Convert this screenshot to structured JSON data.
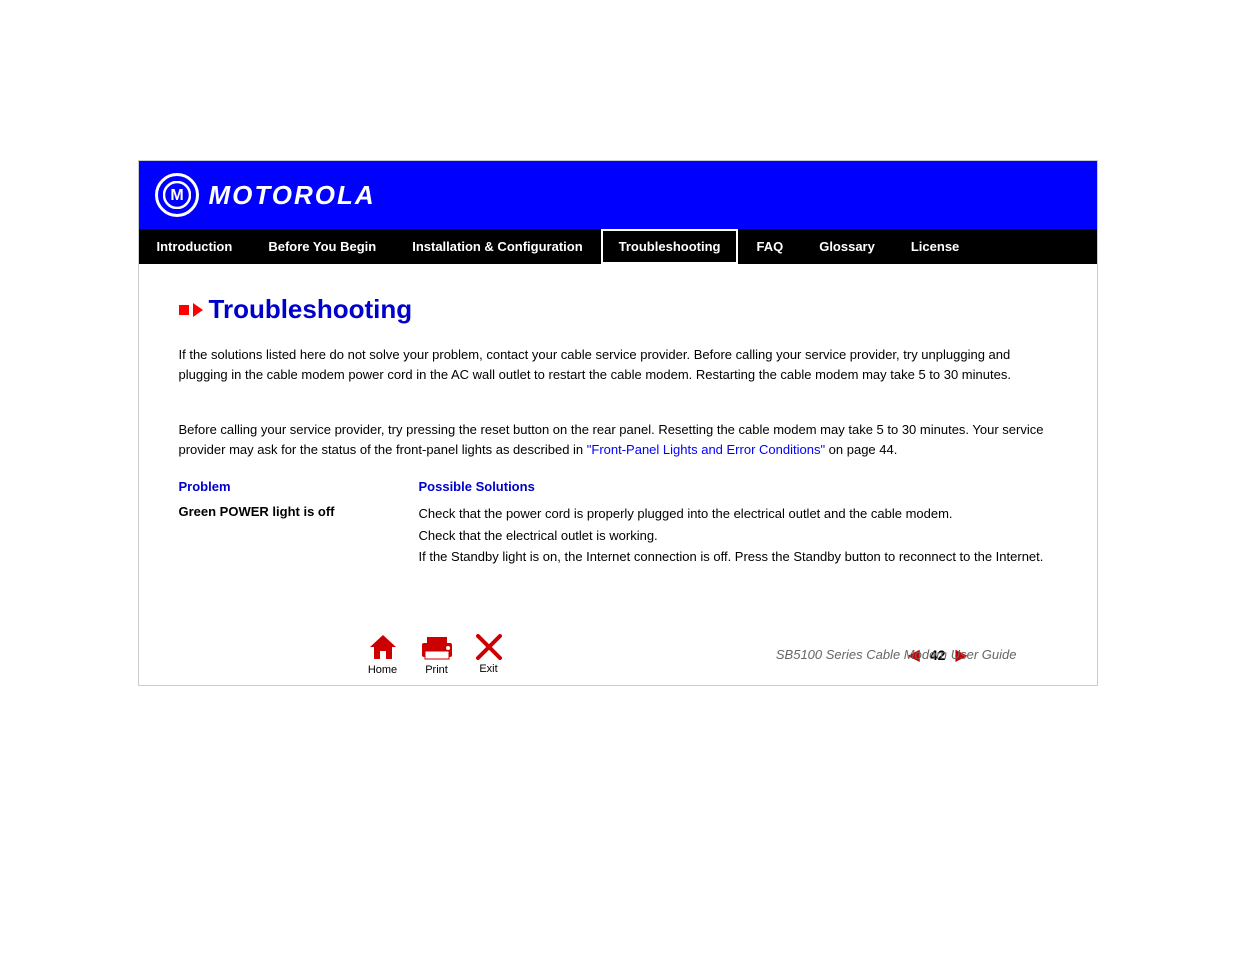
{
  "header": {
    "logo_alt": "Motorola Logo",
    "logo_letter": "M",
    "brand_name": "MOTOROLA"
  },
  "nav": {
    "items": [
      {
        "label": "Introduction",
        "active": false
      },
      {
        "label": "Before You Begin",
        "active": false
      },
      {
        "label": "Installation & Configuration",
        "active": false
      },
      {
        "label": "Troubleshooting",
        "active": true
      },
      {
        "label": "FAQ",
        "active": false
      },
      {
        "label": "Glossary",
        "active": false
      },
      {
        "label": "License",
        "active": false
      }
    ]
  },
  "page": {
    "title": "Troubleshooting",
    "intro_paragraph1": "If the solutions listed here do not solve your problem, contact your cable service provider. Before calling your service provider, try unplugging and plugging in the cable modem power cord in the AC wall outlet to restart the cable modem. Restarting the cable modem may take 5 to 30 minutes.",
    "intro_paragraph2": "Before calling your service provider, try pressing the reset button on the rear panel. Resetting the cable modem may take 5 to 30 minutes. Your service provider may ask for the status of the front-panel lights as described in ",
    "link_text": "\"Front-Panel Lights and Error Conditions\"",
    "link_suffix": " on page 44.",
    "table": {
      "col1_header": "Problem",
      "col2_header": "Possible Solutions",
      "rows": [
        {
          "problem": "Green POWER light is off",
          "solutions": [
            "Check that the power cord is properly plugged into the electrical outlet and the cable modem.",
            "Check that the electrical outlet is working.",
            "If the Standby light is on, the Internet connection is off. Press the Standby button to reconnect to the Internet."
          ]
        }
      ]
    }
  },
  "footer": {
    "home_label": "Home",
    "print_label": "Print",
    "exit_label": "Exit",
    "page_number": "42",
    "guide_title": "SB5100 Series Cable Modem User Guide"
  }
}
